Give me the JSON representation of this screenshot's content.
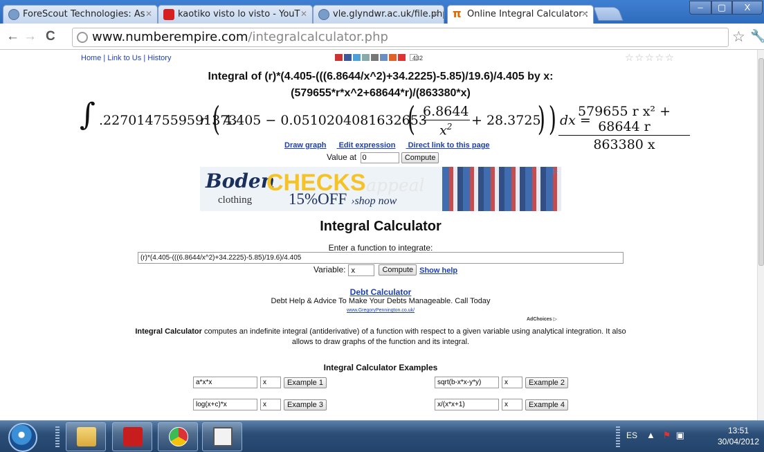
{
  "browser": {
    "tabs": [
      {
        "label": "ForeScout Technologies: As",
        "favicon": "globe-icon"
      },
      {
        "label": "kaotiko visto lo visto - YouT",
        "favicon": "youtube-icon"
      },
      {
        "label": "vle.glyndwr.ac.uk/file.php/",
        "favicon": "globe-icon"
      },
      {
        "label": "Online Integral Calculator :",
        "favicon": "pi-icon",
        "active": true
      }
    ],
    "url_host": "www.numberempire.com",
    "url_path": "/integralcalculator.php",
    "window_controls": {
      "minimize": "–",
      "maximize": "▢",
      "close": "X"
    }
  },
  "page": {
    "top_links": {
      "home": "Home",
      "link_to_us": "Link to Us",
      "history": "History",
      "separator": "|"
    },
    "share_count": "432",
    "rating": "☆☆☆☆☆",
    "result_title_line1": "Integral of (r)*(4.405-(((6.8644/x^2)+34.2225)-5.85)/19.6)/4.405 by x:",
    "result_title_line2": "(579655*r*x^2+68644*r)/(863380*x)",
    "formula": {
      "integral_sign": "∫",
      "coefficient": ".2270147559591373",
      "var_r": "r",
      "inner_a": "4.405 − 0.0510204081632653",
      "frac1_num": "6.8644",
      "frac1_den": "x",
      "frac1_den_sup": "2",
      "plus_term": "+ 28.3725",
      "dx": "dx =",
      "result_num": "579655 r x² + 68644 r",
      "result_den": "863380 x"
    },
    "links": {
      "draw_graph": "Draw graph",
      "edit_expression": "Edit expression",
      "direct_link": "Direct link to this page"
    },
    "value_at": {
      "label": "Value at",
      "value": "0",
      "compute": "Compute"
    },
    "ad_banner": {
      "brand": "Boden",
      "brand_sub": "clothing",
      "headline": "CHECKS",
      "headline_tail": "appeal",
      "offer": "15%OFF",
      "cta": "›shop now"
    },
    "calculator": {
      "heading": "Integral Calculator",
      "prompt": "Enter a function to integrate:",
      "function_value": "(r)*(4.405-(((6.8644/x^2)+34.2225)-5.85)/19.6)/4.405",
      "variable_label": "Variable:",
      "variable_value": "x",
      "compute": "Compute",
      "show_help": "Show help"
    },
    "text_ad": {
      "title": "Debt Calculator",
      "body": "Debt Help & Advice To Make Your Debts Manageable. Call Today",
      "url": "www.GregoryPennington.co.uk/",
      "adchoices": "AdChoices ▷"
    },
    "description_bold": "Integral Calculator",
    "description_rest": " computes an indefinite integral (antiderivative) of a function with respect to a given variable using analytical integration. It also allows to draw graphs of the function and its integral.",
    "examples_heading": "Integral Calculator Examples",
    "examples": [
      {
        "fn": "a*x*x",
        "var": "x",
        "button": "Example 1"
      },
      {
        "fn": "sqrt(b-x*x-y*y)",
        "var": "x",
        "button": "Example 2"
      },
      {
        "fn": "log(x+c)*x",
        "var": "x",
        "button": "Example 3"
      },
      {
        "fn": "x/(x*x+1)",
        "var": "x",
        "button": "Example 4"
      }
    ]
  },
  "taskbar": {
    "language": "ES",
    "time": "13:51",
    "date": "30/04/2012"
  }
}
